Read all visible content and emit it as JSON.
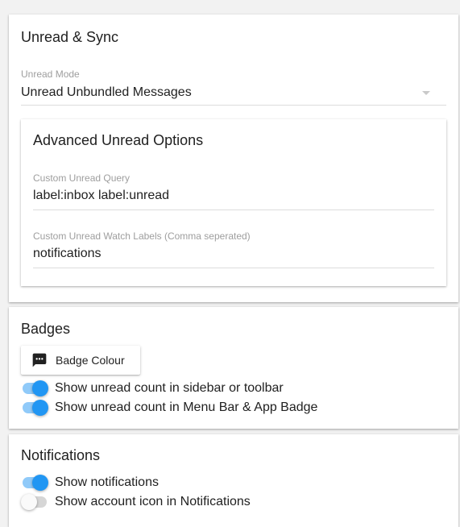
{
  "unread_sync": {
    "title": "Unread & Sync",
    "unread_mode": {
      "label": "Unread Mode",
      "value": "Unread Unbundled Messages",
      "icon": "dropdown-arrow-icon"
    },
    "advanced": {
      "title": "Advanced Unread Options",
      "query": {
        "label": "Custom Unread Query",
        "value": "label:inbox label:unread"
      },
      "watch_labels": {
        "label": "Custom Unread Watch Labels (Comma seperated)",
        "value": "notifications"
      }
    }
  },
  "badges": {
    "title": "Badges",
    "colour_button": {
      "label": "Badge Colour",
      "icon": "chat-bubble-icon"
    },
    "toggles": [
      {
        "label": "Show unread count in sidebar or toolbar",
        "on": true
      },
      {
        "label": "Show unread count in Menu Bar & App Badge",
        "on": true
      }
    ]
  },
  "notifications": {
    "title": "Notifications",
    "toggles": [
      {
        "label": "Show notifications",
        "on": true
      },
      {
        "label": "Show account icon in Notifications",
        "on": false
      }
    ]
  },
  "colors": {
    "accent": "#2196f3",
    "accent_track": "#90caf9",
    "off_track": "#d6d6d6",
    "card_bg": "#ffffff",
    "page_bg": "#f2f2f2"
  }
}
